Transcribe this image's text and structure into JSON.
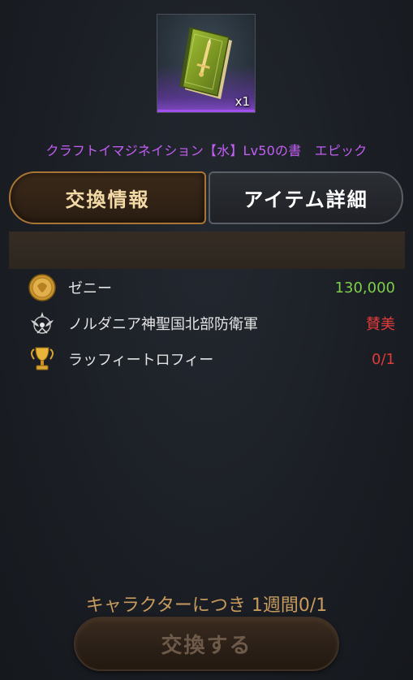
{
  "item": {
    "count": "x1",
    "title": "クラフトイマジネイション【水】Lv50の書　エピック",
    "icon": "green-book-icon",
    "rarity_color": "#a24ff0"
  },
  "tabs": [
    {
      "label": "交換情報",
      "active": true
    },
    {
      "label": "アイテム詳細",
      "active": false
    }
  ],
  "costs": [
    {
      "icon": "zeny-coin-icon",
      "label": "ゼニー",
      "value": "130,000",
      "value_color": "#7ccf4a"
    },
    {
      "icon": "faction-emblem-icon",
      "label": "ノルダニア神聖国北部防衛軍",
      "value": "賛美",
      "value_color": "#e03b3b"
    },
    {
      "icon": "trophy-icon",
      "label": "ラッフィートロフィー",
      "value": "0/1",
      "value_color": "#e03b3b"
    }
  ],
  "limit_text": "キャラクターにつき 1週間0/1",
  "exchange_button": "交換する"
}
